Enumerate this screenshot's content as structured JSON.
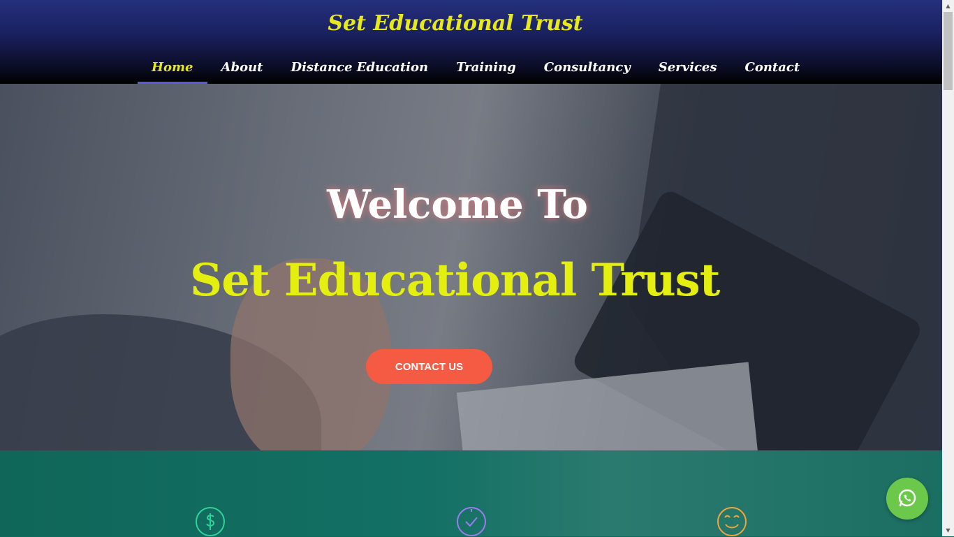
{
  "header": {
    "brand": "Set Educational Trust",
    "nav": [
      {
        "label": "Home",
        "active": true
      },
      {
        "label": "About"
      },
      {
        "label": "Distance Education"
      },
      {
        "label": "Training"
      },
      {
        "label": "Consultancy"
      },
      {
        "label": "Services"
      },
      {
        "label": "Contact"
      }
    ]
  },
  "hero": {
    "welcome": "Welcome To",
    "title": "Set Educational Trust",
    "cta_label": "CONTACT US"
  },
  "features": {
    "icons": [
      "dollar-icon",
      "clock-icon",
      "smiley-icon"
    ]
  },
  "colors": {
    "brand_yellow": "#e4ee0f",
    "cta": "#f45b42",
    "whatsapp": "#6cc84a",
    "nav_underline": "#5b5bd6"
  }
}
